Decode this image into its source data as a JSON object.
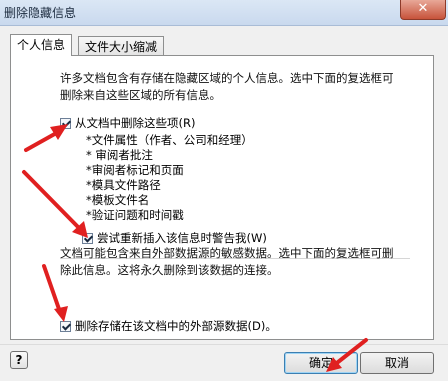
{
  "window": {
    "title": "删除隐藏信息",
    "close_glyph": "✕"
  },
  "tabs": [
    {
      "label": "个人信息",
      "selected": true
    },
    {
      "label": "文件大小缩减",
      "selected": false
    }
  ],
  "personal": {
    "intro": "许多文档包含有存储在隐藏区域的个人信息。选中下面的复选框可删除来自这些区域的所有信息。",
    "remove_label": "从文档中删除这些项(R)",
    "remove_checked": true,
    "items": [
      "*文件属性（作者、公司和经理）",
      "*  审阅者批注",
      "*审阅者标记和页面",
      "*模具文件路径",
      "*模板文件名",
      "*验证问题和时间戳"
    ],
    "warn_label": "尝试重新插入该信息时警告我(W)",
    "warn_checked": true,
    "external_text": "文档可能包含来自外部数据源的敏感数据。选中下面的复选框可删除此信息。这将永久删除到该数据的连接。",
    "external_label": "删除存储在该文档中的外部源数据(D)。",
    "external_checked": true
  },
  "footer": {
    "help_glyph": "?",
    "ok_label": "确定",
    "cancel_label": "取消"
  },
  "colors": {
    "annotation_arrow": "#e02020"
  },
  "icons": {
    "help": "help-icon",
    "close": "close-icon",
    "arrow": "red-arrow-annotation"
  }
}
